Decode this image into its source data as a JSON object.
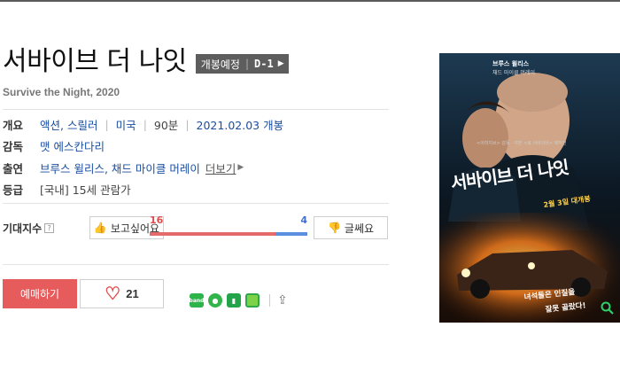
{
  "movie": {
    "title": "서바이브 더 나잇",
    "release_badge": "개봉예정",
    "dday": "D-1",
    "subtitle": "Survive the Night, 2020"
  },
  "info": {
    "overview_label": "개요",
    "genre": "액션, 스릴러",
    "country": "미국",
    "runtime": "90분",
    "release": "2021.02.03 개봉",
    "director_label": "감독",
    "director": "맷 에스칸다리",
    "cast_label": "출연",
    "cast": "브루스 윌리스, 채드 마이클 머레이",
    "more_label": "더보기",
    "rating_label": "등급",
    "rating": "[국내] 15세 관람가"
  },
  "expectation": {
    "label": "기대지수",
    "want_label": "보고싶어요",
    "notwant_label": "글쎄요",
    "want_count": "16",
    "notwant_count": "4",
    "want_ratio": 0.8
  },
  "actions": {
    "reserve_label": "예매하기",
    "like_count": "21"
  },
  "poster": {
    "cast_top": "브루스 윌리스",
    "cast_top2": "채드 마이클 머레이",
    "title": "서바이브 더 나잇",
    "release": "2월 3일 대개봉",
    "tagline1": "녀석들은 인질을",
    "tagline2": "잘못 골랐다!",
    "credit": "<아미지브> 감독 · 각본 <로 서바이버> 제작진"
  },
  "colors": {
    "accent_red": "#e65c5c",
    "accent_blue": "#3f6fd0",
    "badge_bg": "#5d5d5d"
  }
}
